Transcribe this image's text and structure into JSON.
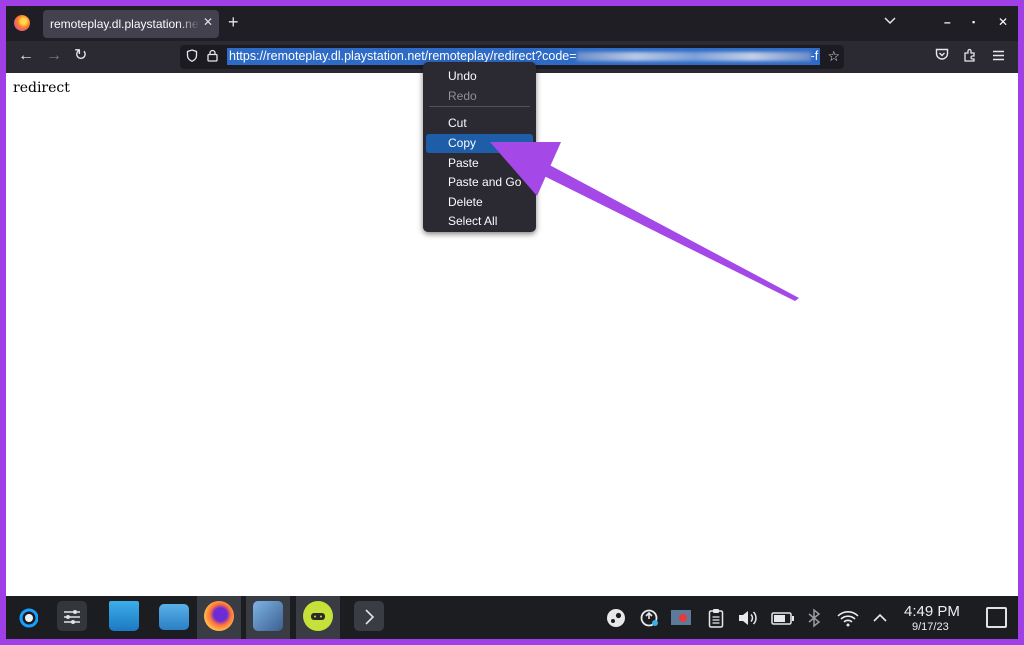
{
  "browser": {
    "tab_title": "remoteplay.dl.playstation.net/remoteplay/redirect?code=",
    "tab_close": "✕",
    "new_tab": "+",
    "tab_list": "⌄",
    "window_controls": {
      "minimize": "–",
      "maximize": "▪",
      "close": "✕"
    },
    "nav": {
      "back": "←",
      "forward": "→",
      "reload": "↻"
    },
    "url_prefix": "https://remoteplay.dl.playstation.net/remoteplay/redirect?code=",
    "url_suffix": "-f",
    "icons": [
      "shield-icon",
      "lock-icon",
      "star-icon",
      "pocket-icon",
      "extensions-icon",
      "menu-icon"
    ]
  },
  "page": {
    "body_text": "redirect"
  },
  "context_menu": {
    "items": [
      {
        "label": "Undo",
        "enabled": true
      },
      {
        "label": "Redo",
        "enabled": false
      },
      {
        "label": "Cut",
        "enabled": true
      },
      {
        "label": "Copy",
        "enabled": true,
        "highlighted": true
      },
      {
        "label": "Paste",
        "enabled": true
      },
      {
        "label": "Paste and Go",
        "enabled": true
      },
      {
        "label": "Delete",
        "enabled": true
      },
      {
        "label": "Select All",
        "enabled": true
      }
    ]
  },
  "annotation": {
    "arrow_color": "#a448e8"
  },
  "taskbar": {
    "apps": [
      "steam-deck-icon",
      "system-settings-icon",
      "discover-icon",
      "dolphin-file-manager-icon",
      "firefox-icon",
      "chiaki-icon",
      "remote-play-icon",
      "more-icon"
    ],
    "tray": [
      "steam-tray-icon",
      "update-icon",
      "recording-icon",
      "clipboard-icon",
      "volume-icon",
      "battery-icon",
      "bluetooth-icon",
      "wifi-icon",
      "expand-tray-icon"
    ],
    "time": "4:49 PM",
    "date": "9/17/23"
  },
  "colors": {
    "frame": "#a03fe6",
    "menu_highlight": "#1e5ea8",
    "url_selection": "#2e6bc6"
  }
}
